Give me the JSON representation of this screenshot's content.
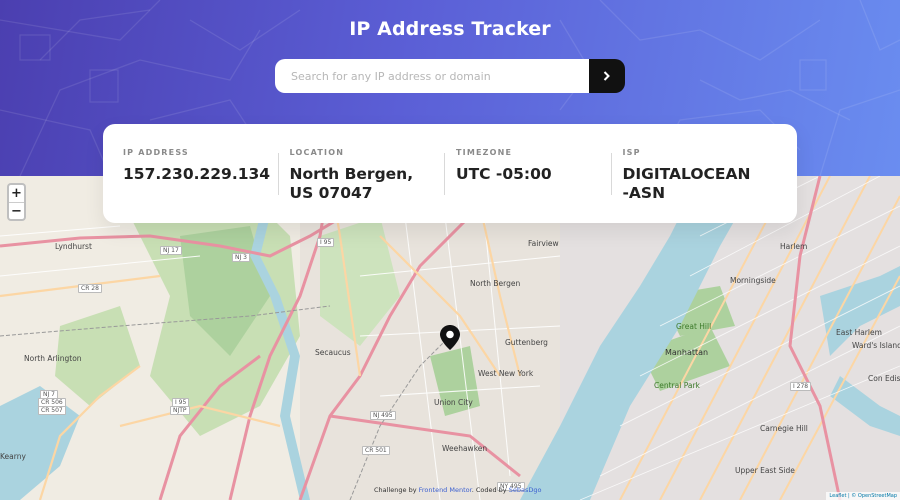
{
  "app": {
    "title": "IP Address Tracker"
  },
  "search": {
    "placeholder": "Search for any IP address or domain",
    "submit_icon": "chevron-right-icon"
  },
  "info": [
    {
      "label": "IP ADDRESS",
      "value": "157.230.229.134"
    },
    {
      "label": "LOCATION",
      "value": "North Bergen, US 07047"
    },
    {
      "label": "TIMEZONE",
      "value": "UTC -05:00"
    },
    {
      "label": "ISP",
      "value": "DIGITALOCEAN-ASN"
    }
  ],
  "map": {
    "zoom_in": "+",
    "zoom_out": "−",
    "marker_icon": "location-pin-icon",
    "labels": [
      "Lyndhurst",
      "Fairview",
      "North Bergen",
      "North Arlington",
      "Secaucus",
      "Guttenberg",
      "West New York",
      "Union City",
      "Weehawken",
      "Manhattan",
      "Central Park",
      "Great Hill",
      "Morningside",
      "Harlem",
      "East Harlem",
      "Carnegie Hill",
      "Upper East Side",
      "Ward's Island",
      "Con Edison",
      "Kearny"
    ],
    "shields": [
      "NJ 17",
      "NJ 3",
      "I 95",
      "CR 28",
      "NJ 7",
      "CR 506",
      "CR 507",
      "I 95",
      "NJTP",
      "NJ 495",
      "CR 501",
      "NY 495",
      "I 278"
    ],
    "attribution_prefix": "Challenge by",
    "attribution_fm": "Frontend Mentor",
    "attribution_mid": ". Coded by",
    "attribution_author": "SebasDgo",
    "leaflet_attr": "Leaflet | © OpenStreetMap"
  },
  "colors": {
    "header_gradient_start": "#4b3fb0",
    "header_gradient_end": "#6a8df0",
    "water": "#aad3df",
    "park": "#add19e",
    "highway": "#e892a2",
    "primary_road": "#fcd6a4",
    "urban": "#e0dfdf"
  }
}
